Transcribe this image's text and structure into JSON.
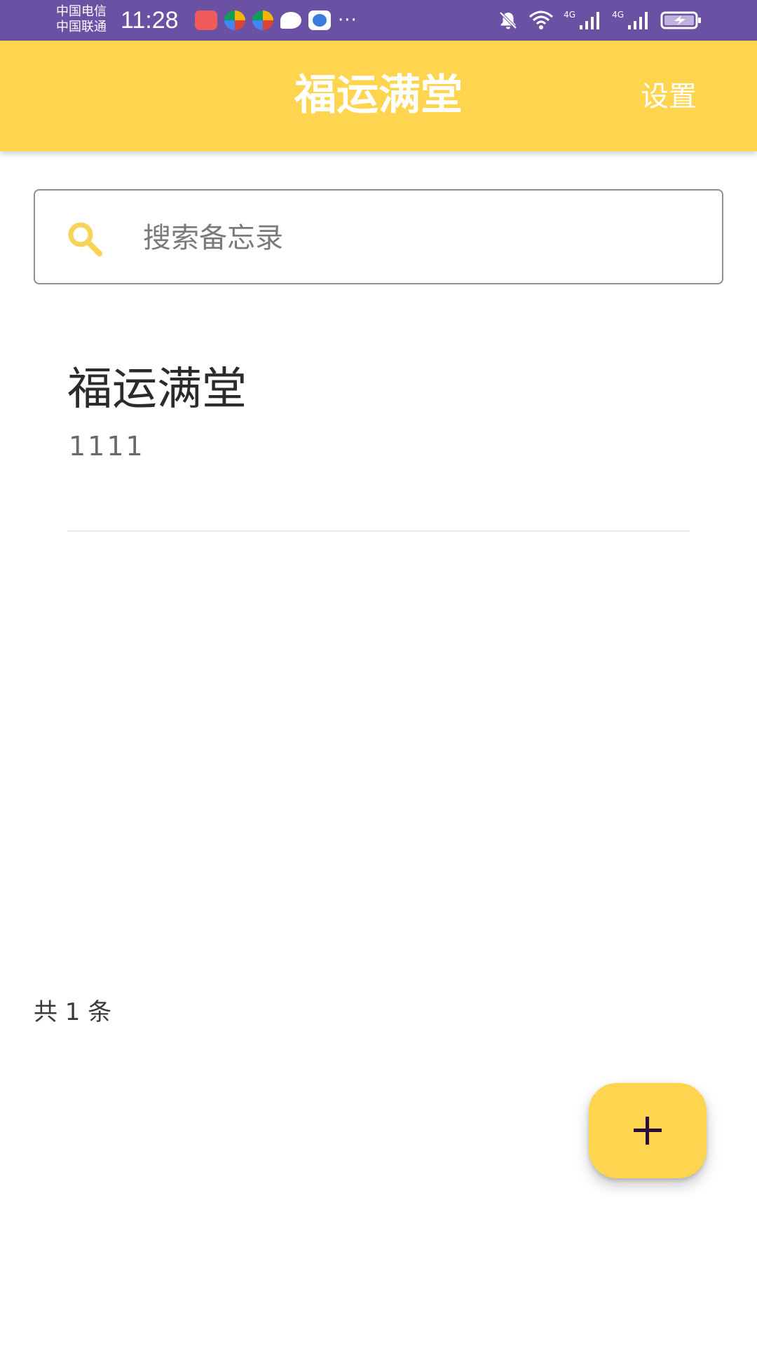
{
  "status_bar": {
    "carrier_1": "中国电信",
    "carrier_2": "中国联通",
    "time": "11:28",
    "more": "···",
    "network_1": "4G",
    "network_2": "4G",
    "notification_icons": [
      "huawei-app-icon",
      "app-icon",
      "app-icon",
      "chat-bubble-icon",
      "browser-icon"
    ],
    "system_icons": [
      "bell-off-icon",
      "wifi-icon",
      "signal-icon",
      "signal-icon",
      "battery-charging-icon"
    ],
    "bg_color": "#6b51a4"
  },
  "app_bar": {
    "title": "福运满堂",
    "settings_label": "设置",
    "bg_color": "#ffd54f"
  },
  "search": {
    "placeholder": "搜索备忘录",
    "value": "",
    "icon": "search-icon",
    "icon_color": "#f7d35a"
  },
  "memos": [
    {
      "title": "福运满堂",
      "content": "1111"
    }
  ],
  "footer": {
    "count_label": "共 1 条"
  },
  "fab": {
    "icon": "plus-icon",
    "bg_color": "#ffd54f",
    "icon_color": "#2c0d3f"
  }
}
